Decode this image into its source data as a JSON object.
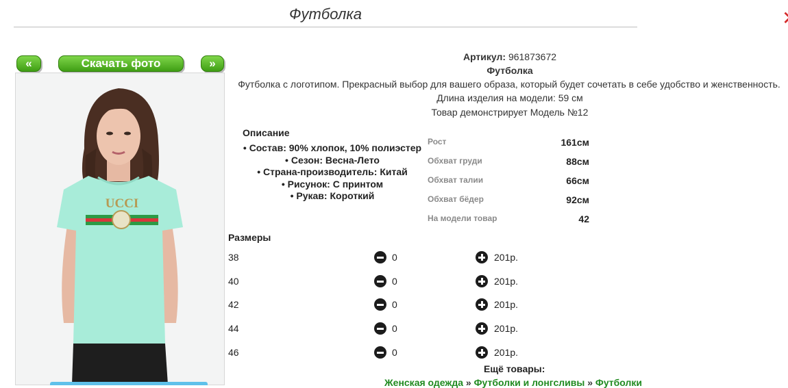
{
  "page": {
    "title": "Футболка"
  },
  "nav": {
    "prev_label": "«",
    "download_label": "Скачать фото",
    "next_label": "»"
  },
  "product": {
    "article_label": "Артикул:",
    "article_value": "961873672",
    "name": "Футболка",
    "description": "Футболка с логотипом. Прекрасный выбор для вашего образа, который будет сочетать в себе удобство и женственность.",
    "length": "Длина изделия на модели: 59 см",
    "model_note": "Товар демонстрирует Модель №12"
  },
  "details": {
    "heading": "Описание",
    "items": [
      "Состав: 90% хлопок, 10% полиэстер",
      "Сезон: Весна-Лето",
      "Страна-производитель: Китай",
      "Рисунок: С принтом",
      "Рукав: Короткий"
    ]
  },
  "measurements": [
    {
      "label": "Рост",
      "value": "161см"
    },
    {
      "label": "Обхват груди",
      "value": "88см"
    },
    {
      "label": "Обхват талии",
      "value": "66см"
    },
    {
      "label": "Обхват бёдер",
      "value": "92см"
    },
    {
      "label": "На модели товар",
      "value": "42"
    }
  ],
  "sizes": {
    "heading": "Размеры",
    "rows": [
      {
        "size": "38",
        "qty": "0",
        "price": "201р."
      },
      {
        "size": "40",
        "qty": "0",
        "price": "201р."
      },
      {
        "size": "42",
        "qty": "0",
        "price": "201р."
      },
      {
        "size": "44",
        "qty": "0",
        "price": "201р."
      },
      {
        "size": "46",
        "qty": "0",
        "price": "201р."
      }
    ]
  },
  "more": {
    "heading": "Ещё товары:",
    "crumbs": [
      "Женская одежда",
      "Футболки и лонгсливы",
      "Футболки"
    ],
    "separator": "»"
  },
  "photo": {
    "print_text": "UCCI"
  },
  "colors": {
    "accent_green": "#3f9e14",
    "link_green": "#1f8a1f",
    "shirt": "#a8ecd9",
    "close_red": "#d42a2a"
  }
}
